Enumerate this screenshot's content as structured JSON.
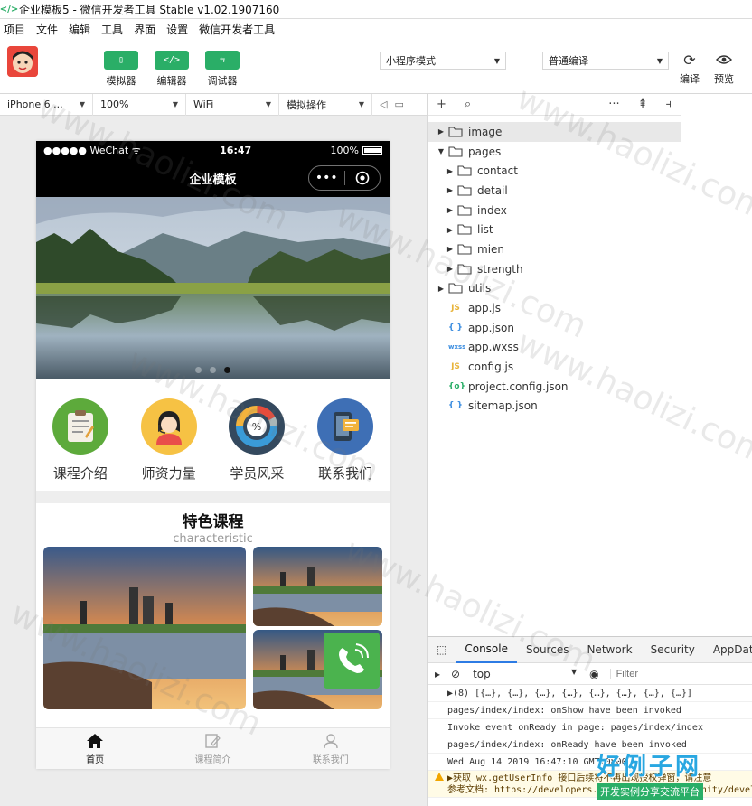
{
  "window": {
    "title": "企业模板5 - 微信开发者工具 Stable v1.02.1907160"
  },
  "menu": [
    "项目",
    "文件",
    "编辑",
    "工具",
    "界面",
    "设置",
    "微信开发者工具"
  ],
  "toolbar": {
    "simulator": "模拟器",
    "editor": "编辑器",
    "debugger": "调试器",
    "mode_select": "小程序模式",
    "compile_select": "普通编译",
    "compile": "编译",
    "preview": "预览"
  },
  "devicebar": {
    "device": "iPhone 6 ...",
    "zoom": "100%",
    "network": "WiFi",
    "operation": "模拟操作"
  },
  "phone": {
    "carrier": "●●●●● WeChat",
    "time": "16:47",
    "battery": "100%",
    "nav_title": "企业模板",
    "capsule_more": "•••"
  },
  "icon_nav": [
    {
      "label": "课程介绍"
    },
    {
      "label": "师资力量"
    },
    {
      "label": "学员风采"
    },
    {
      "label": "联系我们"
    }
  ],
  "feature": {
    "title": "特色课程",
    "subtitle": "characteristic"
  },
  "tabbar": [
    {
      "label": "首页"
    },
    {
      "label": "课程简介"
    },
    {
      "label": "联系我们"
    }
  ],
  "tree": [
    {
      "label": "image",
      "type": "folder",
      "expanded": false,
      "selected": true
    },
    {
      "label": "pages",
      "type": "folder",
      "expanded": true
    },
    {
      "label": "contact",
      "type": "folder",
      "indent": 1
    },
    {
      "label": "detail",
      "type": "folder",
      "indent": 1
    },
    {
      "label": "index",
      "type": "folder",
      "indent": 1
    },
    {
      "label": "list",
      "type": "folder",
      "indent": 1
    },
    {
      "label": "mien",
      "type": "folder",
      "indent": 1
    },
    {
      "label": "strength",
      "type": "folder",
      "indent": 1
    },
    {
      "label": "utils",
      "type": "folder",
      "expanded": false
    },
    {
      "label": "app.js",
      "type": "js"
    },
    {
      "label": "app.json",
      "type": "json"
    },
    {
      "label": "app.wxss",
      "type": "wxss"
    },
    {
      "label": "config.js",
      "type": "js"
    },
    {
      "label": "project.config.json",
      "type": "config"
    },
    {
      "label": "sitemap.json",
      "type": "json"
    }
  ],
  "console": {
    "tabs": [
      "Console",
      "Sources",
      "Network",
      "Security",
      "AppData"
    ],
    "context": "top",
    "filter_placeholder": "Filter",
    "lines": [
      "▶(8) [{…}, {…}, {…}, {…}, {…}, {…}, {…}, {…}]",
      "pages/index/index: onShow have been invoked",
      "Invoke event onReady in page: pages/index/index",
      "pages/index/index: onReady have been invoked",
      "Wed Aug 14 2019 16:47:10 GMT+0800"
    ],
    "warning_line1": "▶获取 wx.getUserInfo 接口后续将不再出现授权弹窗，请注意",
    "warning_line2": "参考文档: https://developers.weixin.qq.com/community/develop/detail"
  },
  "watermark": {
    "text": "www.haolizi.com",
    "logo_big": "好例子网",
    "logo_small": "开发实例分享交流平台"
  },
  "colors": {
    "accent_green": "#2aae67",
    "tab_active": "#2d7be4",
    "nav_black": "#000000"
  }
}
